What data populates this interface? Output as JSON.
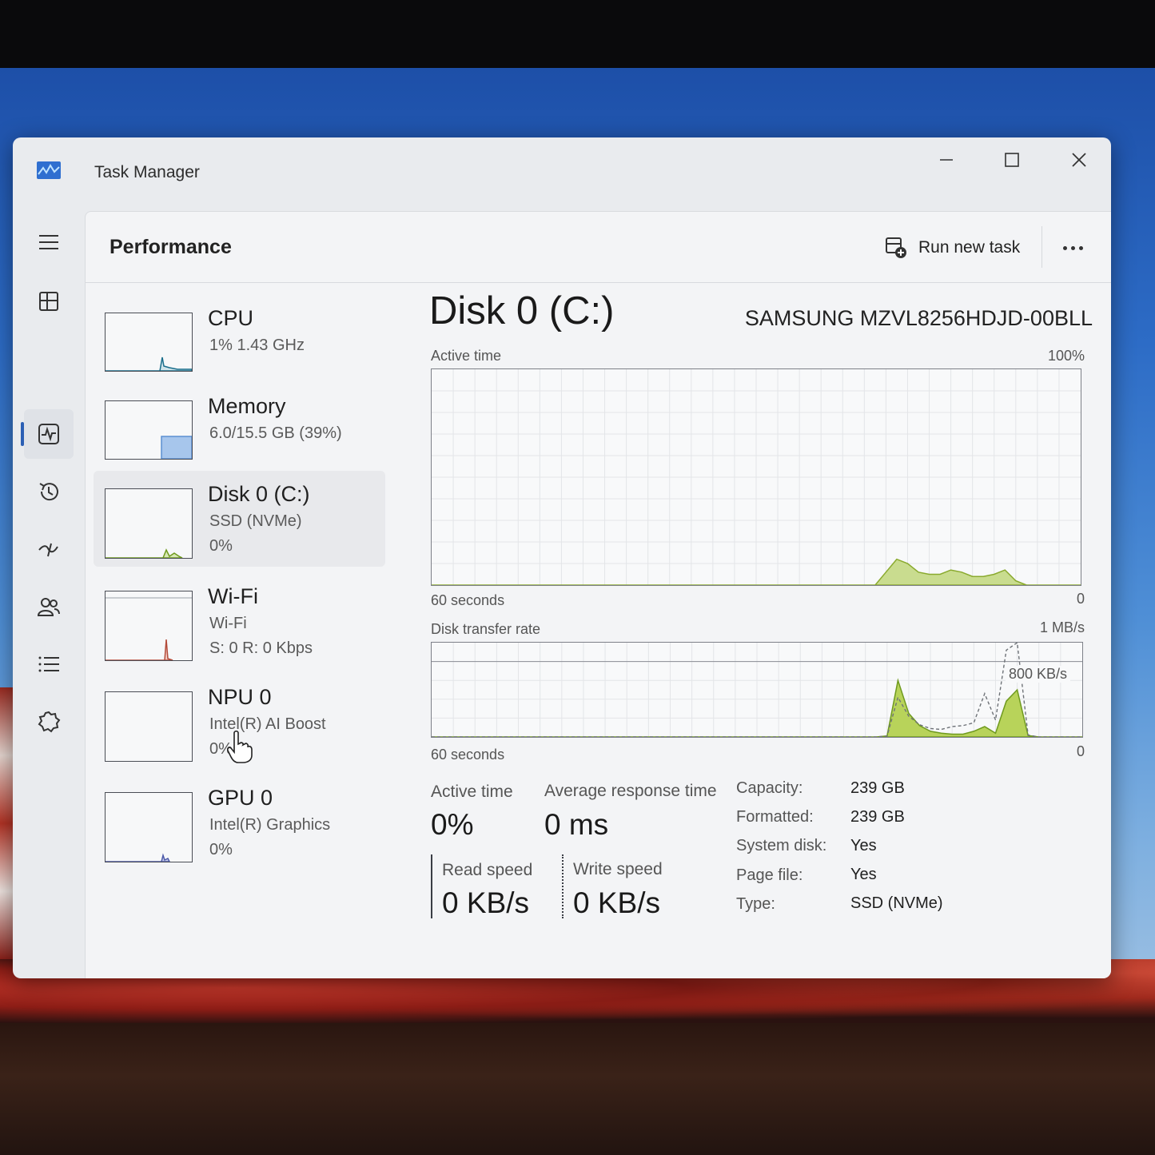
{
  "window": {
    "title": "Task Manager"
  },
  "nav": {
    "items": [
      {
        "icon": "hamburger-menu-icon"
      },
      {
        "icon": "processes-icon"
      },
      {
        "icon": "performance-icon",
        "active": true
      },
      {
        "icon": "app-history-icon"
      },
      {
        "icon": "startup-apps-icon"
      },
      {
        "icon": "users-icon"
      },
      {
        "icon": "details-icon"
      },
      {
        "icon": "services-icon"
      },
      {
        "icon": "settings-icon"
      }
    ]
  },
  "header": {
    "title": "Performance",
    "run_new_task": "Run new task"
  },
  "resources": [
    {
      "name": "CPU",
      "line1": "1%  1.43 GHz",
      "line2": "",
      "color": "#1a6e8c"
    },
    {
      "name": "Memory",
      "line1": "6.0/15.5 GB (39%)",
      "line2": "",
      "color": "#5b8fd1"
    },
    {
      "name": "Disk 0 (C:)",
      "line1": "SSD (NVMe)",
      "line2": "0%",
      "color": "#6f9a1e",
      "selected": true
    },
    {
      "name": "Wi-Fi",
      "line1": "Wi-Fi",
      "line2": "S: 0  R: 0 Kbps",
      "color": "#b34b3a"
    },
    {
      "name": "NPU 0",
      "line1": "Intel(R) AI Boost",
      "line2": "0%",
      "color": "#1a6e8c"
    },
    {
      "name": "GPU 0",
      "line1": "Intel(R) Graphics",
      "line2": "0%",
      "color": "#4a58a8"
    }
  ],
  "detail": {
    "title": "Disk 0 (C:)",
    "model": "SAMSUNG MZVL8256HDJD-00BLL",
    "active_chart": {
      "label": "Active time",
      "max": "100%",
      "time": "60 seconds",
      "min": "0"
    },
    "transfer_chart": {
      "label": "Disk transfer rate",
      "max": "1 MB/s",
      "mid": "800 KB/s",
      "time": "60 seconds",
      "min": "0"
    },
    "stats": {
      "active_time_label": "Active time",
      "active_time": "0%",
      "resp_label": "Average response time",
      "resp": "0 ms",
      "read_label": "Read speed",
      "read": "0 KB/s",
      "write_label": "Write speed",
      "write": "0 KB/s"
    },
    "props": [
      {
        "k": "Capacity:",
        "v": "239 GB"
      },
      {
        "k": "Formatted:",
        "v": "239 GB"
      },
      {
        "k": "System disk:",
        "v": "Yes"
      },
      {
        "k": "Page file:",
        "v": "Yes"
      },
      {
        "k": "Type:",
        "v": "SSD (NVMe)"
      }
    ]
  },
  "chart_data": [
    {
      "type": "area",
      "title": "Active time",
      "xlabel": "60 seconds",
      "ylim": [
        0,
        100
      ],
      "series": [
        {
          "values": [
            0,
            0,
            0,
            0,
            0,
            0,
            0,
            0,
            0,
            0,
            0,
            0,
            0,
            0,
            0,
            0,
            0,
            0,
            0,
            0,
            0,
            0,
            0,
            0,
            0,
            0,
            0,
            0,
            0,
            0,
            0,
            0,
            0,
            0,
            0,
            0,
            0,
            0,
            0,
            0,
            0,
            0,
            6,
            12,
            10,
            6,
            5,
            5,
            7,
            6,
            4,
            4,
            5,
            7,
            2,
            0,
            0,
            0,
            0,
            0,
            0
          ]
        }
      ],
      "color": "#9cbd43"
    },
    {
      "type": "area",
      "title": "Disk transfer rate",
      "xlabel": "60 seconds",
      "ylim": [
        0,
        1000
      ],
      "series": [
        {
          "name": "read",
          "values": [
            0,
            0,
            0,
            0,
            0,
            0,
            0,
            0,
            0,
            0,
            0,
            0,
            0,
            0,
            0,
            0,
            0,
            0,
            0,
            0,
            0,
            0,
            0,
            0,
            0,
            0,
            0,
            0,
            0,
            0,
            0,
            0,
            0,
            0,
            0,
            0,
            0,
            0,
            0,
            0,
            0,
            0,
            10,
            600,
            250,
            120,
            60,
            40,
            30,
            30,
            60,
            110,
            40,
            380,
            500,
            15,
            0,
            0,
            0,
            0,
            0
          ]
        },
        {
          "name": "write",
          "values": [
            0,
            0,
            0,
            0,
            0,
            0,
            0,
            0,
            0,
            0,
            0,
            0,
            0,
            0,
            0,
            0,
            0,
            0,
            0,
            0,
            0,
            0,
            0,
            0,
            0,
            0,
            0,
            0,
            0,
            0,
            0,
            0,
            0,
            0,
            0,
            0,
            0,
            0,
            0,
            0,
            0,
            0,
            10,
            420,
            220,
            130,
            90,
            80,
            110,
            120,
            150,
            460,
            180,
            920,
            1000,
            20,
            0,
            0,
            0,
            0,
            0
          ]
        }
      ],
      "color": "#9cbd43"
    }
  ]
}
